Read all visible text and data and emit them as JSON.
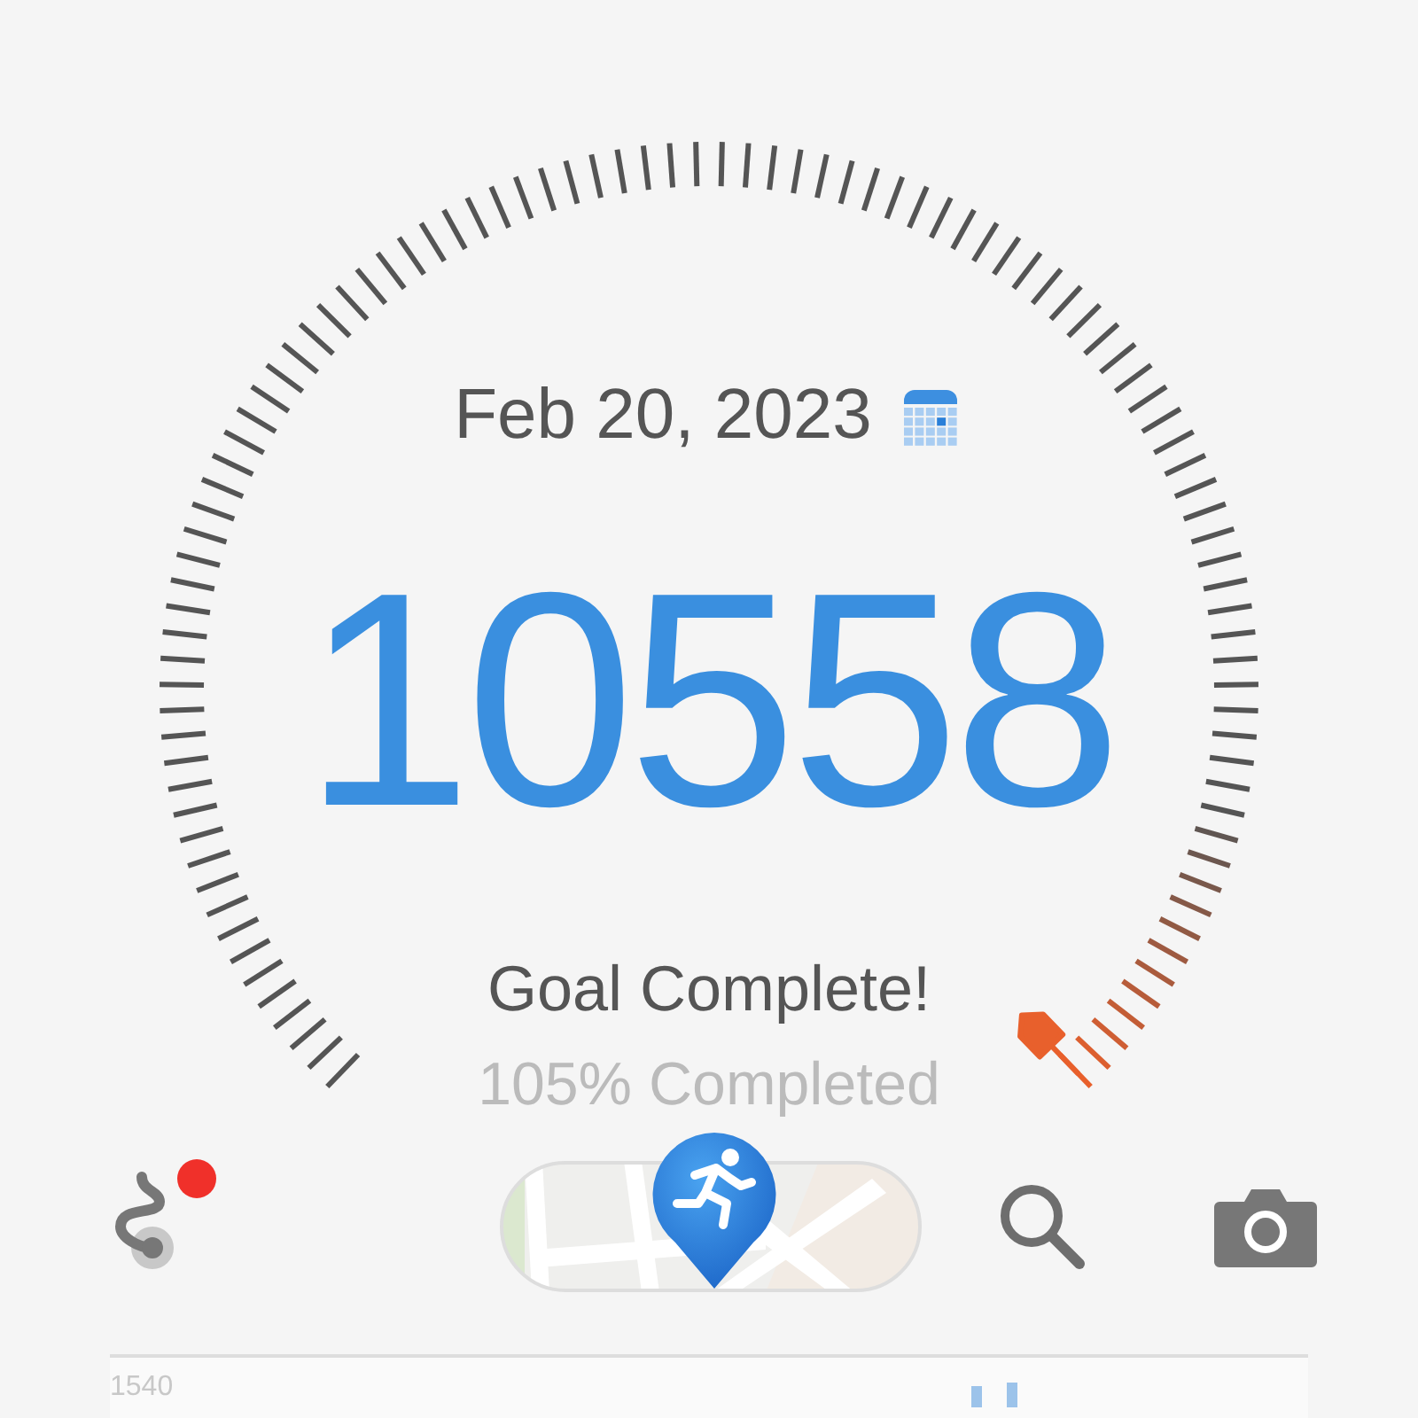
{
  "date": "Feb 20, 2023",
  "steps": "10558",
  "goal_status": "Goal Complete!",
  "completion": "105% Completed",
  "toolbar": {
    "route_notification": true
  },
  "chart": {
    "top_label": "1540"
  }
}
